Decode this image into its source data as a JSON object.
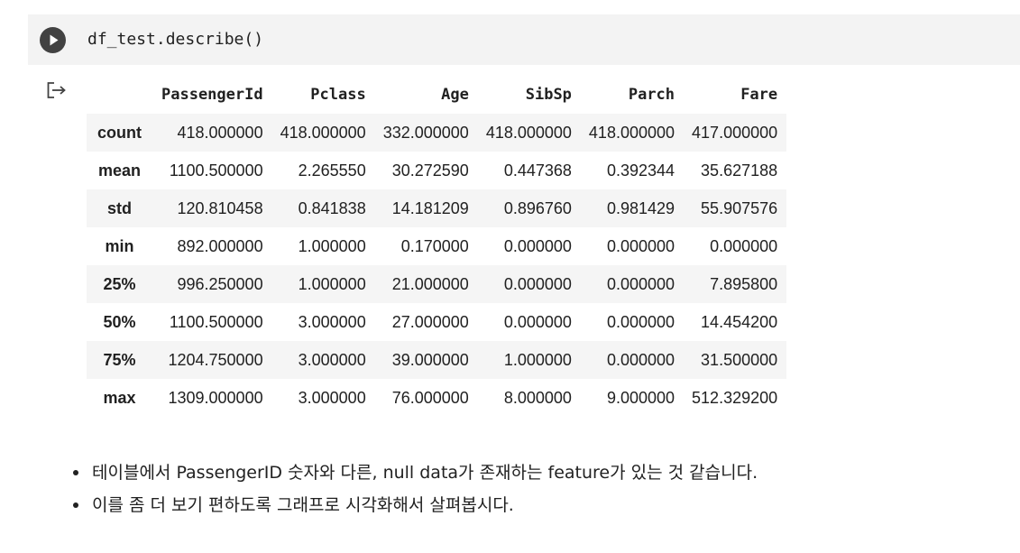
{
  "code_cell": {
    "code": "df_test.describe()",
    "run_icon": "play-icon"
  },
  "output": {
    "icon": "output-arrow-icon",
    "table": {
      "columns": [
        "PassengerId",
        "Pclass",
        "Age",
        "SibSp",
        "Parch",
        "Fare"
      ],
      "rows": [
        {
          "label": "count",
          "values": [
            "418.000000",
            "418.000000",
            "332.000000",
            "418.000000",
            "418.000000",
            "417.000000"
          ]
        },
        {
          "label": "mean",
          "values": [
            "1100.500000",
            "2.265550",
            "30.272590",
            "0.447368",
            "0.392344",
            "35.627188"
          ]
        },
        {
          "label": "std",
          "values": [
            "120.810458",
            "0.841838",
            "14.181209",
            "0.896760",
            "0.981429",
            "55.907576"
          ]
        },
        {
          "label": "min",
          "values": [
            "892.000000",
            "1.000000",
            "0.170000",
            "0.000000",
            "0.000000",
            "0.000000"
          ]
        },
        {
          "label": "25%",
          "values": [
            "996.250000",
            "1.000000",
            "21.000000",
            "0.000000",
            "0.000000",
            "7.895800"
          ]
        },
        {
          "label": "50%",
          "values": [
            "1100.500000",
            "3.000000",
            "27.000000",
            "0.000000",
            "0.000000",
            "14.454200"
          ]
        },
        {
          "label": "75%",
          "values": [
            "1204.750000",
            "3.000000",
            "39.000000",
            "1.000000",
            "0.000000",
            "31.500000"
          ]
        },
        {
          "label": "max",
          "values": [
            "1309.000000",
            "3.000000",
            "76.000000",
            "8.000000",
            "9.000000",
            "512.329200"
          ]
        }
      ]
    }
  },
  "notes": [
    "테이블에서 PassengerID 숫자와 다른, null data가 존재하는 feature가 있는 것 같습니다.",
    "이를 좀 더 보기 편하도록 그래프로 시각화해서 살펴봅시다."
  ]
}
